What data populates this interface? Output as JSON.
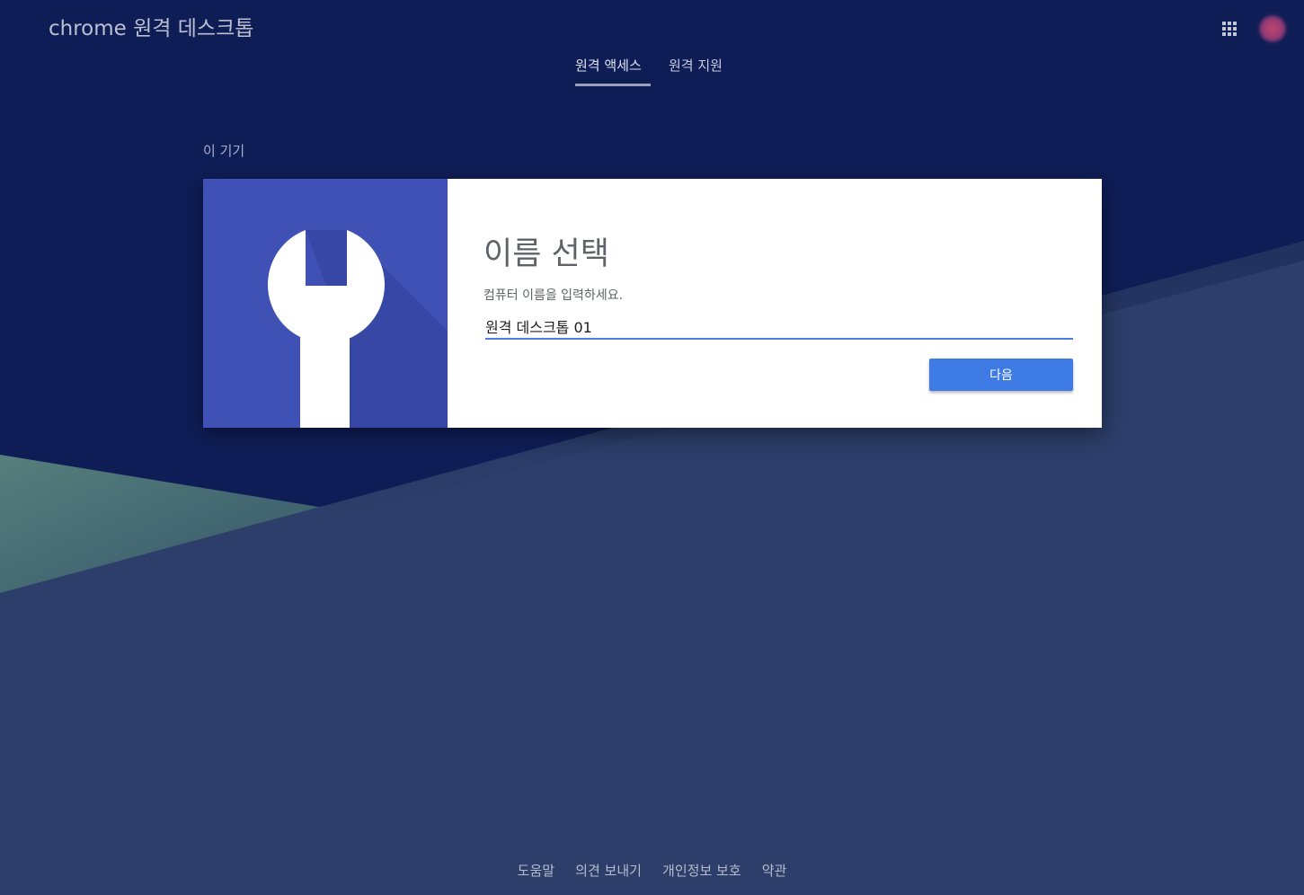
{
  "app": {
    "brand_prefix": "chrome",
    "brand_suffix": "원격 데스크톱"
  },
  "tabs": [
    {
      "label": "원격 액세스",
      "active": true
    },
    {
      "label": "원격 지원",
      "active": false
    }
  ],
  "section": {
    "label": "이 기기"
  },
  "setup_card": {
    "title": "이름 선택",
    "subtitle": "컴퓨터 이름을 입력하세요.",
    "computer_name_value": "원격 데스크톱 01",
    "next_button_label": "다음",
    "art_icon": "wrench-icon"
  },
  "footer": {
    "links": [
      "도움말",
      "의견 보내기",
      "개인정보 보호",
      "약관"
    ]
  },
  "icons": {
    "apps": "apps-grid-icon",
    "account": "account-avatar"
  },
  "colors": {
    "background_top": "#0f1d57",
    "background_bottom": "#2c3e69",
    "card_art": "#3f51b5",
    "accent_button": "#3e7be5",
    "input_underline": "#4c7ddf"
  }
}
